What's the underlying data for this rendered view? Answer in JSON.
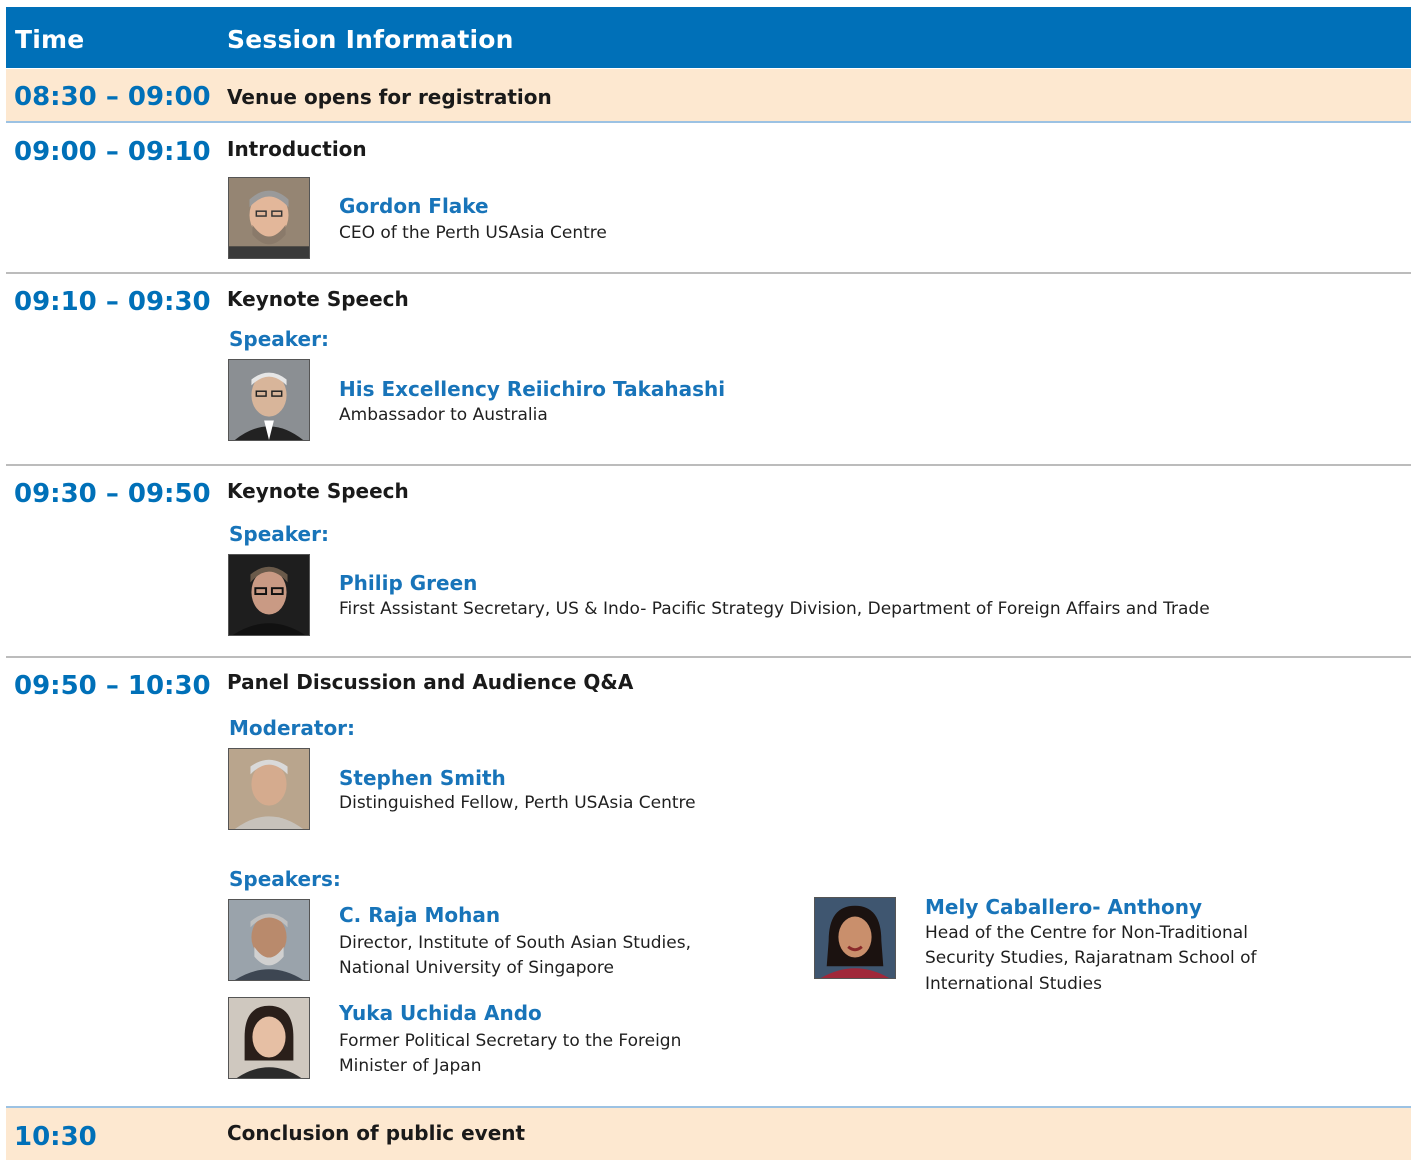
{
  "header": {
    "time_label": "Time",
    "session_label": "Session Information"
  },
  "sessions": [
    {
      "time": "08:30 – 09:00",
      "title": "Venue opens for registration"
    },
    {
      "time": "09:00 – 09:10",
      "title": "Introduction",
      "people": [
        {
          "name": "Gordon Flake",
          "title": "CEO of the Perth USAsia Centre"
        }
      ]
    },
    {
      "time": "09:10 – 09:30",
      "title": "Keynote Speech",
      "role": "Speaker:",
      "people": [
        {
          "name": "His Excellency Reiichiro Takahashi",
          "title": "Ambassador to Australia"
        }
      ]
    },
    {
      "time": "09:30 – 09:50",
      "title": "Keynote Speech",
      "role": "Speaker:",
      "people": [
        {
          "name": "Philip Green",
          "title": "First Assistant Secretary, US & Indo- Pacific Strategy Division, Department of Foreign Affairs and Trade"
        }
      ]
    },
    {
      "time": "09:50 – 10:30",
      "title": "Panel Discussion and Audience Q&A",
      "moderator_label": "Moderator:",
      "moderator": {
        "name": "Stephen Smith",
        "title": "Distinguished Fellow, Perth USAsia Centre"
      },
      "speakers_label": "Speakers:",
      "speakers": [
        {
          "name": "C. Raja Mohan",
          "title_line1": "Director, Institute of South Asian Studies,",
          "title_line2": "National University of Singapore"
        },
        {
          "name": "Yuka Uchida Ando",
          "title_line1": "Former Political Secretary to the Foreign",
          "title_line2": "Minister of Japan"
        },
        {
          "name": "Mely Caballero- Anthony",
          "title_line1": "Head of the Centre for Non-Traditional",
          "title_line2": "Security Studies, Rajaratnam School of",
          "title_line3": "International Studies"
        }
      ]
    },
    {
      "time": "10:30",
      "title": "Conclusion of public event"
    }
  ],
  "colors": {
    "header": "#0070b8",
    "band": "#fde8d0",
    "accent": "#1874b9"
  },
  "icons": [
    "portrait-photo"
  ]
}
